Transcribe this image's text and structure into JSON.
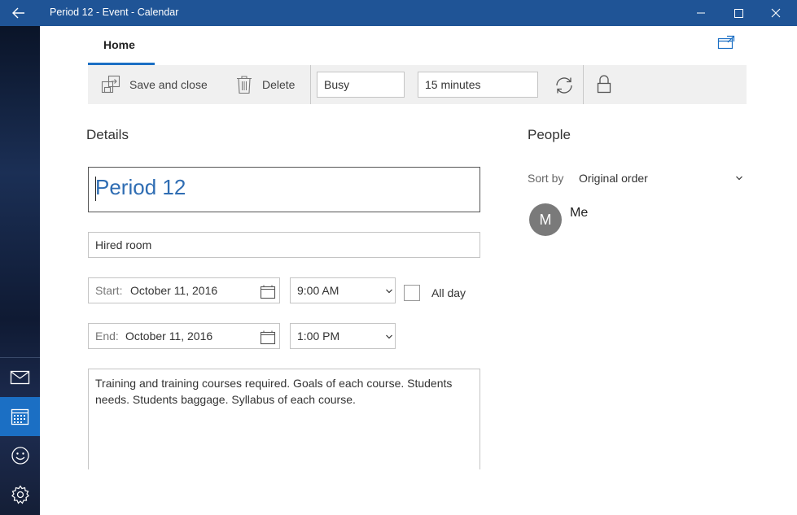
{
  "window": {
    "title": "Period 12 - Event - Calendar"
  },
  "tabs": {
    "home": "Home"
  },
  "toolbar": {
    "save_label": "Save and close",
    "delete_label": "Delete",
    "show_as": "Busy",
    "reminder": "15 minutes"
  },
  "details": {
    "heading": "Details",
    "event_title": "Period 12",
    "location": "Hired room",
    "start_label": "Start:",
    "start_date": "October 11, 2016",
    "start_time": "9:00 AM",
    "all_day_label": "All day",
    "all_day_checked": false,
    "end_label": "End:",
    "end_date": "October 11, 2016",
    "end_time": "1:00 PM",
    "notes": "Training and training courses required. Goals of each course. Students needs. Students baggage. Syllabus of each course."
  },
  "people": {
    "heading": "People",
    "sort_label": "Sort by",
    "sort_value": "Original order",
    "attendees": [
      {
        "initial": "M",
        "name": "Me"
      }
    ]
  },
  "colors": {
    "titlebar": "#1f5496",
    "accent": "#1b6fc4",
    "title_text": "#2f6db3"
  }
}
